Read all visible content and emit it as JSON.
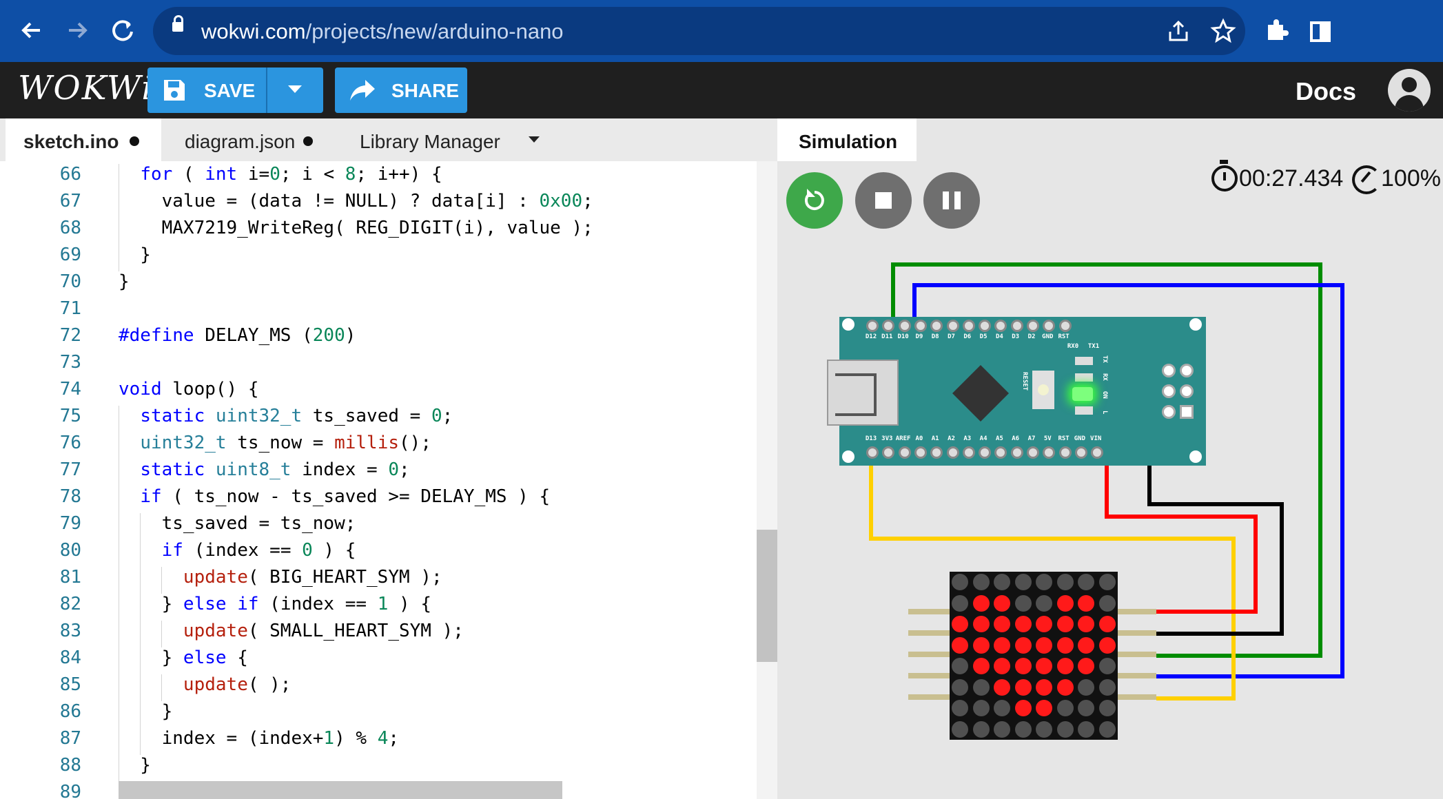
{
  "browser": {
    "url_host": "wokwi.com",
    "url_path": "/projects/new/arduino-nano",
    "icons": [
      "back-icon",
      "forward-icon",
      "reload-icon",
      "lock-icon",
      "share-icon",
      "star-icon",
      "extensions-icon",
      "sidepanel-icon"
    ]
  },
  "header": {
    "logo": "WOKWi",
    "save_label": "SAVE",
    "share_label": "SHARE",
    "docs_label": "Docs"
  },
  "editor": {
    "tabs": [
      {
        "label": "sketch.ino",
        "modified": true,
        "active": true
      },
      {
        "label": "diagram.json",
        "modified": true,
        "active": false
      },
      {
        "label": "Library Manager",
        "modified": false,
        "active": false
      }
    ],
    "line_numbers": [
      "66",
      "67",
      "68",
      "69",
      "70",
      "71",
      "72",
      "73",
      "74",
      "75",
      "76",
      "77",
      "78",
      "79",
      "80",
      "81",
      "82",
      "83",
      "84",
      "85",
      "86",
      "87",
      "88",
      "89"
    ],
    "lines": [
      "  for ( int i=0; i < 8; i++) {",
      "    value = (data != NULL) ? data[i] : 0x00;",
      "    MAX7219_WriteReg( REG_DIGIT(i), value );",
      "  }",
      "}",
      "",
      "#define DELAY_MS (200)",
      "",
      "void loop() {",
      "  static uint32_t ts_saved = 0;",
      "  uint32_t ts_now = millis();",
      "  static uint8_t index = 0;",
      "  if ( ts_now - ts_saved >= DELAY_MS ) {",
      "    ts_saved = ts_now;",
      "    if (index == 0 ) {",
      "      update( BIG_HEART_SYM );",
      "    } else if (index == 1 ) {",
      "      update( SMALL_HEART_SYM );",
      "    } else {",
      "      update( );",
      "    }",
      "    index = (index+1) % 4;",
      "  }",
      "}"
    ]
  },
  "simulation": {
    "tab_label": "Simulation",
    "timer": "00:27.434",
    "speed": "100%",
    "controls": [
      "restart",
      "stop",
      "pause"
    ],
    "nano": {
      "top_pins": [
        "D12",
        "D11",
        "D10",
        "D9",
        "D8",
        "D7",
        "D6",
        "D5",
        "D4",
        "D3",
        "D2",
        "GND",
        "RST",
        "RX0",
        "TX1"
      ],
      "bottom_pins": [
        "D13",
        "3V3",
        "AREF",
        "A0",
        "A1",
        "A2",
        "A3",
        "A4",
        "A5",
        "A6",
        "A7",
        "5V",
        "RST",
        "GND",
        "VIN"
      ],
      "led_labels": [
        "TX",
        "RX",
        "ON",
        "L"
      ],
      "reset_label": "RESET"
    },
    "matrix_rows": [
      "00000000",
      "01100110",
      "11111111",
      "11111111",
      "01111110",
      "00111100",
      "00011000",
      "00000000"
    ],
    "colors": {
      "board": "#2b8c8a",
      "led_on": "#ff1a1a",
      "led_off": "#505050",
      "wire_green": "#008c00",
      "wire_blue": "#0000ff",
      "wire_yellow": "#ffd000",
      "wire_red": "#ff0000",
      "wire_black": "#000000"
    }
  }
}
